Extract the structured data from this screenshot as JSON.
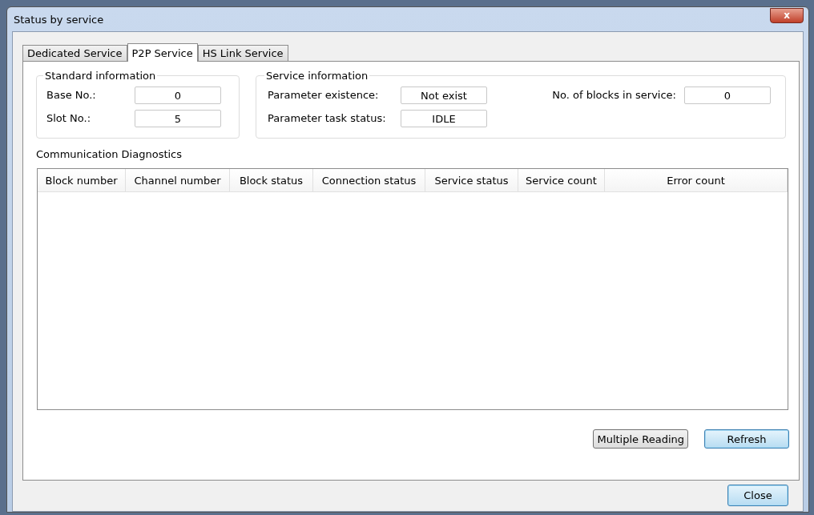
{
  "window": {
    "title": "Status by service",
    "close_label": "x"
  },
  "tabs": [
    {
      "label": "Dedicated Service",
      "selected": false
    },
    {
      "label": "P2P Service",
      "selected": true
    },
    {
      "label": "HS Link Service",
      "selected": false
    }
  ],
  "standard_information": {
    "title": "Standard information",
    "fields": [
      {
        "label": "Base No.:",
        "value": "0"
      },
      {
        "label": "Slot No.:",
        "value": "5"
      }
    ]
  },
  "service_information": {
    "title": "Service information",
    "fields": [
      {
        "label": "Parameter existence:",
        "value": "Not exist"
      },
      {
        "label": "Parameter task status:",
        "value": "IDLE"
      }
    ],
    "blocks_field": {
      "label": "No. of blocks in service:",
      "value": "0"
    }
  },
  "diagnostics": {
    "title": "Communication Diagnostics",
    "columns": [
      "Block number",
      "Channel number",
      "Block status",
      "Connection status",
      "Service status",
      "Service count",
      "Error count"
    ]
  },
  "panel_buttons": [
    {
      "label": "Multiple Reading",
      "kind": "plain"
    },
    {
      "label": "Refresh",
      "kind": "default"
    }
  ],
  "close_button": {
    "label": "Close"
  }
}
